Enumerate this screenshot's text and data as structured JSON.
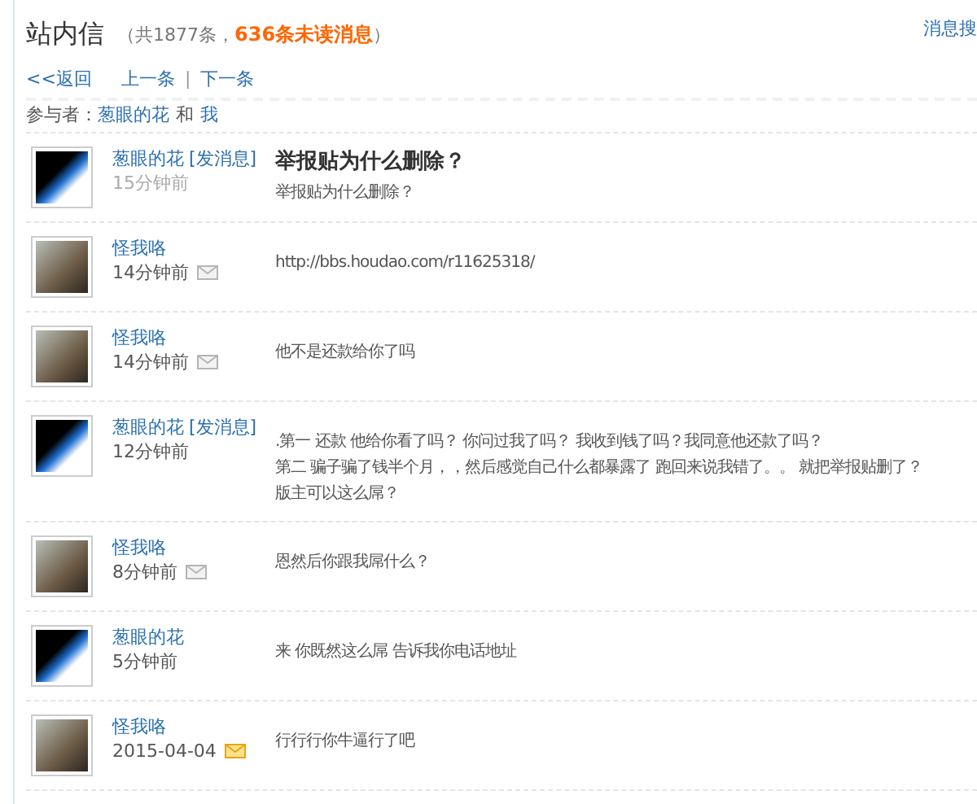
{
  "header": {
    "title": "站内信",
    "count_open": "（共1877条，",
    "unread": "636条未读消息",
    "count_close": "）",
    "search_link": "消息搜"
  },
  "nav": {
    "back": "<<返回",
    "prev": "上一条",
    "separator": "|",
    "next": "下一条"
  },
  "participants": {
    "label": "参与者：",
    "first": "葱眼的花",
    "joiner": "和",
    "second": "我"
  },
  "messages": [
    {
      "from_me": false,
      "sender": "葱眼的花",
      "send_link": "[发消息]",
      "time": "15分钟前",
      "time_muted": true,
      "subject": "举报贴为什么删除？",
      "lines": [
        "举报贴为什么删除？"
      ]
    },
    {
      "from_me": true,
      "sender": "怪我咯",
      "time": "14分钟前",
      "time_muted": false,
      "unread": false,
      "lines": [
        "http://bbs.houdao.com/r11625318/"
      ]
    },
    {
      "from_me": true,
      "sender": "怪我咯",
      "time": "14分钟前",
      "time_muted": false,
      "unread": false,
      "lines": [
        "他不是还款给你了吗"
      ]
    },
    {
      "from_me": false,
      "sender": "葱眼的花",
      "send_link": "[发消息]",
      "time": "12分钟前",
      "time_muted": false,
      "lines": [
        ".第一 还款 他给你看了吗？ 你问过我了吗？ 我收到钱了吗？我同意他还款了吗？",
        "第二 骗子骗了钱半个月，，然后感觉自己什么都暴露了 跑回来说我错了。。 就把举报贴删了？",
        "版主可以这么屌？"
      ]
    },
    {
      "from_me": true,
      "sender": "怪我咯",
      "time": "8分钟前",
      "time_muted": false,
      "unread": false,
      "lines": [
        "恩然后你跟我屌什么？"
      ]
    },
    {
      "from_me": false,
      "sender": "葱眼的花",
      "time": "5分钟前",
      "time_muted": false,
      "lines": [
        "来 你既然这么屌 告诉我你电话地址"
      ]
    },
    {
      "from_me": true,
      "sender": "怪我咯",
      "time": "2015-04-04",
      "time_muted": false,
      "unread": true,
      "lines": [
        "行行行你牛逼行了吧"
      ]
    }
  ]
}
